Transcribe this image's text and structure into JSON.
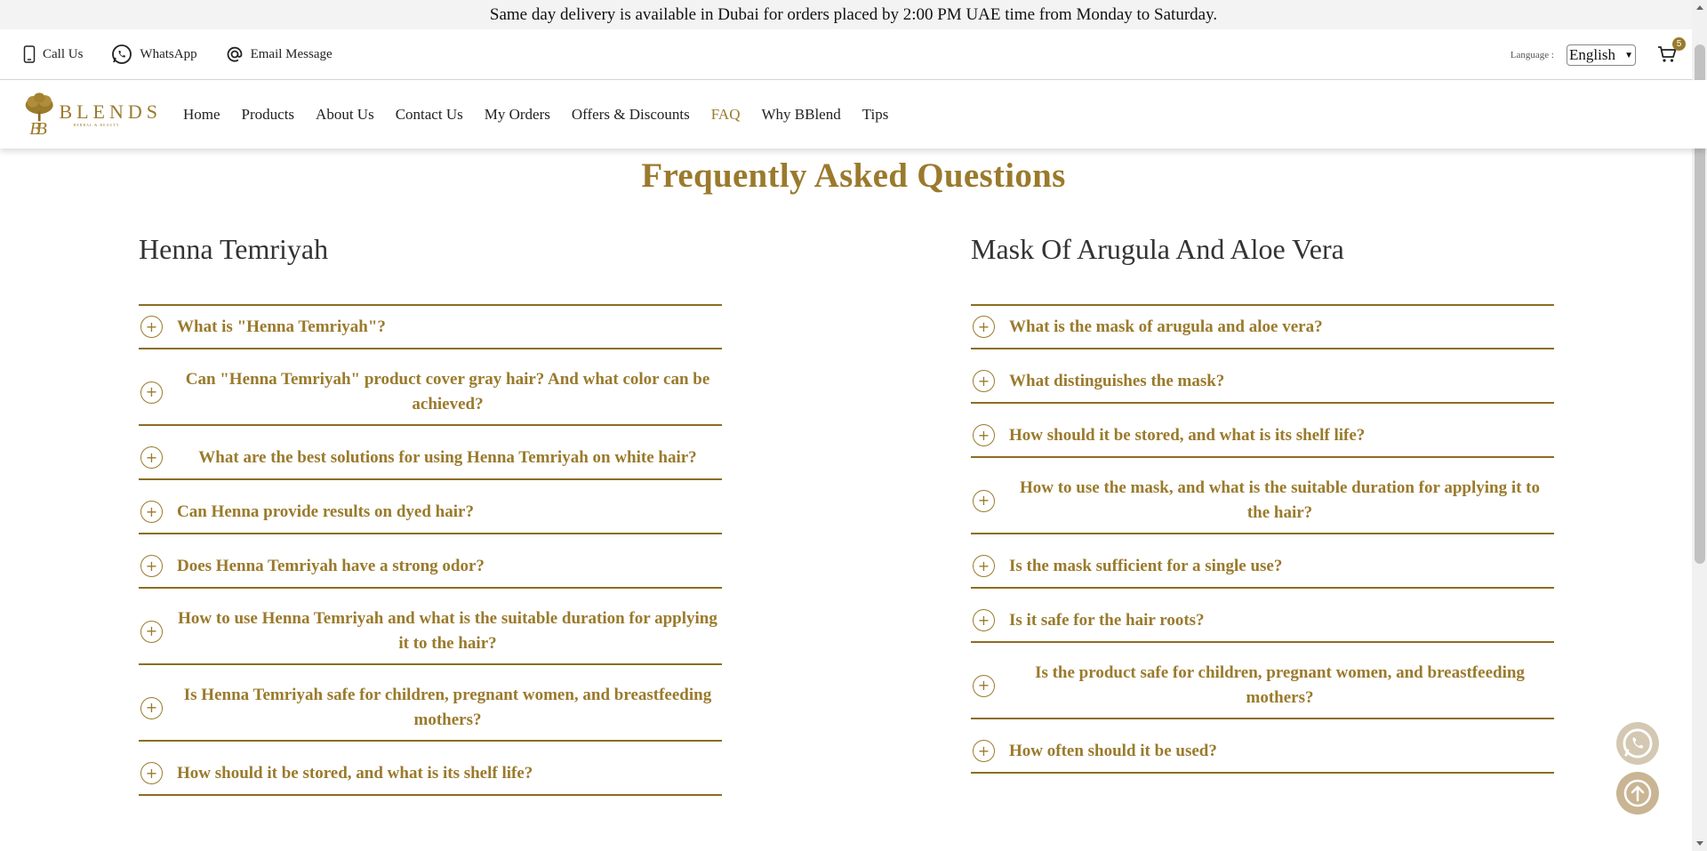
{
  "announcement": "Same day delivery is available in Dubai for orders placed by 2:00 PM UAE time from Monday to Saturday.",
  "contact": {
    "call_label": "Call Us",
    "whatsapp_label": "WhatsApp",
    "email_label": "Email Message"
  },
  "language": {
    "label": "Language :",
    "selected": "English"
  },
  "cart": {
    "count": "5"
  },
  "brand": {
    "name": "BLENDS",
    "tagline": "HERBAL & BEAUTY"
  },
  "nav": {
    "home": "Home",
    "products": "Products",
    "about": "About Us",
    "contact": "Contact Us",
    "orders": "My Orders",
    "offers": "Offers & Discounts",
    "faq": "FAQ",
    "why": "Why BBlend",
    "tips": "Tips"
  },
  "page_title": "Frequently Asked Questions",
  "sections": [
    {
      "title": "Henna Temriyah",
      "questions": [
        "What is \"Henna Temriyah\"?",
        "Can \"Henna Temriyah\" product cover gray hair? And what color can be achieved?",
        "What are the best solutions for using Henna Temriyah on white hair?",
        "Can Henna provide results on dyed hair?",
        "Does Henna Temriyah have a strong odor?",
        "How to use Henna Temriyah and what is the suitable duration for applying it to the hair?",
        "Is Henna Temriyah safe for children, pregnant women, and breastfeeding mothers?",
        "How should it be stored, and what is its shelf life?"
      ]
    },
    {
      "title": "Mask Of Arugula And Aloe Vera",
      "questions": [
        "What is the mask of arugula and aloe vera?",
        "What distinguishes the mask?",
        "How should it be stored, and what is its shelf life?",
        "How to use the mask, and what is the suitable duration for applying it to the hair?",
        "Is the mask sufficient for a single use?",
        "Is it safe for the hair roots?",
        "Is the product safe for children, pregnant women, and breastfeeding mothers?",
        "How often should it be used?"
      ]
    }
  ],
  "colors": {
    "accent": "#9a7a2c",
    "divider": "#8c6d22"
  }
}
